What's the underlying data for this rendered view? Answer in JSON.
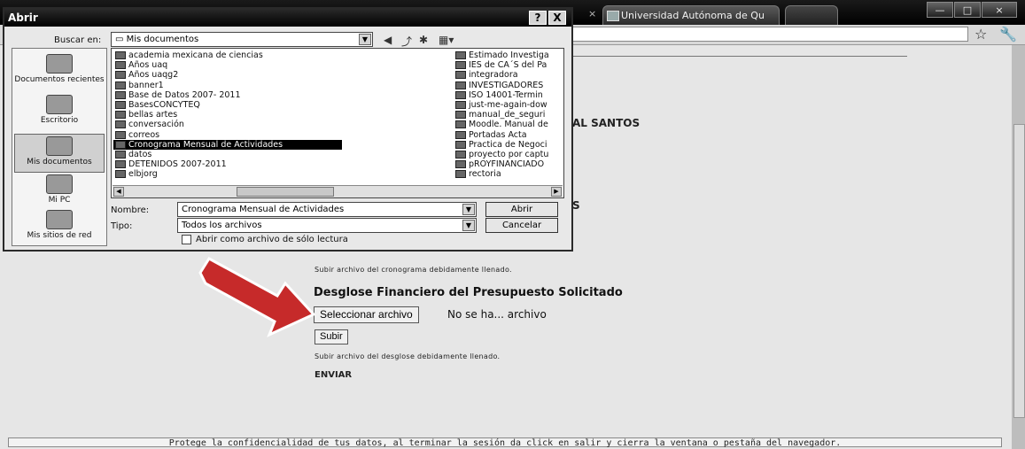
{
  "browser": {
    "tab_title": "Universidad Autónoma de Qu",
    "tab_close": "×",
    "min": "—",
    "max": "□",
    "close": "×"
  },
  "page": {
    "partial_name": "AL SANTOS",
    "partial_s": "S",
    "upload_note_1": "Subir archivo del cronograma debidamente llenado.",
    "heading": "Desglose Financiero del Presupuesto Solicitado",
    "choose_file": "Seleccionar archivo",
    "no_file": "No se ha... archivo",
    "upload": "Subir",
    "upload_note_2": "Subir archivo del desglose debidamente llenado.",
    "send": "ENVIAR",
    "footer": "Protege la confidencialidad de tus datos, al terminar la sesión da click en salir y cierra la ventana o pestaña del navegador."
  },
  "dialog": {
    "title": "Abrir",
    "help": "?",
    "close": "X",
    "look_in_label": "Buscar en:",
    "look_in_value": "Mis documentos",
    "places": [
      {
        "label": "Documentos recientes"
      },
      {
        "label": "Escritorio"
      },
      {
        "label": "Mis documentos"
      },
      {
        "label": "Mi PC"
      },
      {
        "label": "Mis sitios de red"
      }
    ],
    "files_left": [
      "academia mexicana de ciencias",
      "Años uaq",
      "Años uaqg2",
      "banner1",
      "Base de Datos 2007- 2011",
      "BasesCONCYTEQ",
      "bellas artes",
      "conversación",
      "correos",
      "Cronograma Mensual de Actividades",
      "datos",
      "DETENIDOS 2007-2011",
      "elbjorg"
    ],
    "files_right": [
      "Estimado Investiga",
      "IES de CA´S del Pa",
      "integradora",
      "INVESTIGADORES",
      "ISO 14001-Termin",
      "just-me-again-dow",
      "manual_de_seguri",
      "Moodle. Manual de",
      "Portadas Acta",
      "Practica de Negoci",
      "proyecto por captu",
      "pROYFINANCIADO",
      "rectoria"
    ],
    "name_label": "Nombre:",
    "name_value": "Cronograma Mensual de Actividades",
    "type_label": "Tipo:",
    "type_value": "Todos los archivos",
    "open_button": "Abrir",
    "cancel_button": "Cancelar",
    "readonly_label": "Abrir como archivo de sólo lectura"
  }
}
